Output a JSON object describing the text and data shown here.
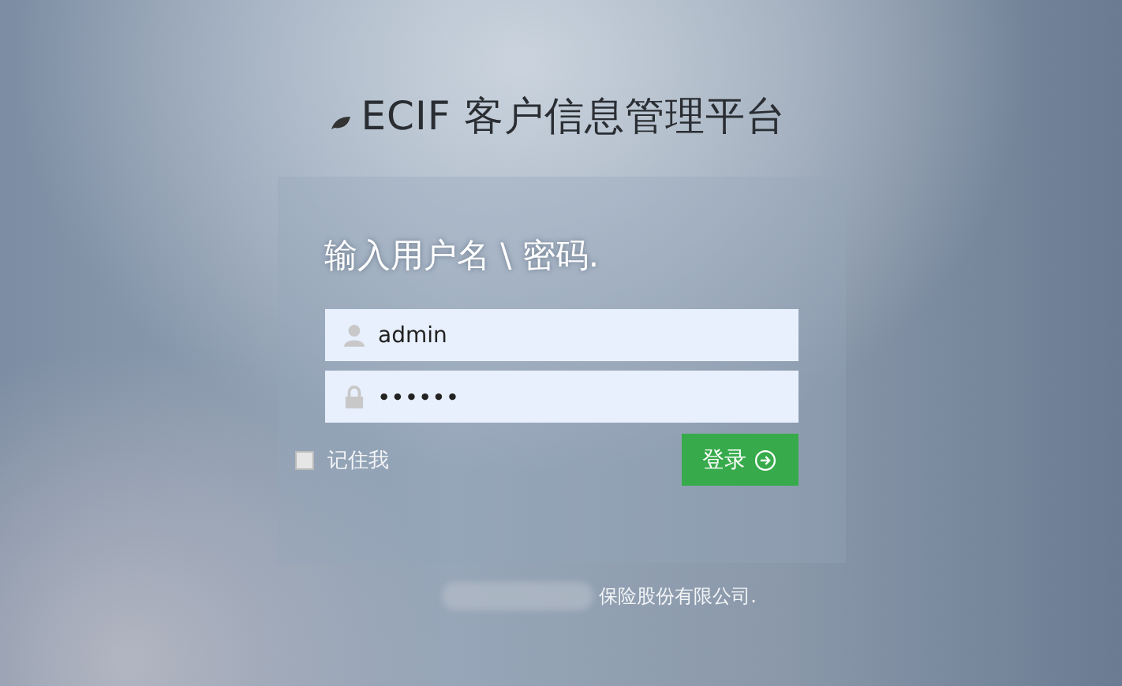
{
  "header": {
    "title": "ECIF 客户信息管理平台"
  },
  "login": {
    "heading": "输入用户名 \\ 密码.",
    "fields": [
      {
        "kind": "user",
        "value": "admin"
      },
      {
        "kind": "password",
        "value": "••••••"
      }
    ],
    "remember": {
      "label": "记住我",
      "checked": false
    },
    "submit": {
      "label": "登录"
    }
  },
  "footer": {
    "text": "保险股份有限公司."
  }
}
